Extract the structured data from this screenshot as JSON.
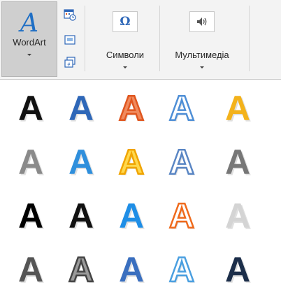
{
  "ribbon": {
    "wordart": {
      "label": "WordArt",
      "glyph": "A",
      "icon": "wordart-icon"
    },
    "small_buttons": [
      {
        "name": "date-time-icon"
      },
      {
        "name": "object-icon"
      },
      {
        "name": "slide-number-icon"
      }
    ],
    "symbols": {
      "label": "Символи",
      "glyph": "Ω",
      "icon": "omega-icon"
    },
    "multimedia": {
      "label": "Мультимедіа",
      "icon": "speaker-icon"
    }
  },
  "gallery": {
    "glyph": "A",
    "styles": [
      {
        "name": "wordart-fill-black-shadow",
        "fill": "#111111"
      },
      {
        "name": "wordart-fill-blue-accent1-shadow",
        "fill": "#2e67b8"
      },
      {
        "name": "wordart-fill-white-outline-orange",
        "fill": "#f08a5d",
        "stroke": "#e0561f"
      },
      {
        "name": "wordart-fill-white-outline-blue",
        "fill": "#ffffff",
        "stroke": "#4f8fd6"
      },
      {
        "name": "wordart-fill-gold-accent4",
        "fill": "#f3b21b"
      },
      {
        "name": "wordart-gradient-gray",
        "fill": "#8a8a8a"
      },
      {
        "name": "wordart-gradient-blue-reflection",
        "fill": "#2f8fdc"
      },
      {
        "name": "wordart-gradient-gold-outline",
        "fill": "#ffd84d",
        "stroke": "#f0a400"
      },
      {
        "name": "wordart-white-outline-blue-shadow",
        "fill": "#ffffff",
        "stroke": "#5a86c4"
      },
      {
        "name": "wordart-gradient-dark-gray",
        "fill": "#777777"
      },
      {
        "name": "wordart-fill-black-glow",
        "fill": "#000000"
      },
      {
        "name": "wordart-fill-black-blue-shadow",
        "fill": "#111111"
      },
      {
        "name": "wordart-fill-blue-bevel",
        "fill": "#1f8ee6"
      },
      {
        "name": "wordart-white-outline-orange-shadow",
        "fill": "#ffffff",
        "stroke": "#ef6a1c"
      },
      {
        "name": "wordart-light-gray-bevel",
        "fill": "#d4d4d4"
      },
      {
        "name": "wordart-pattern-dark-gray",
        "fill": "#555555"
      },
      {
        "name": "wordart-outline-gray-pattern",
        "fill": "#9a9a9a",
        "stroke": "#444444"
      },
      {
        "name": "wordart-blue-3d",
        "fill": "#3a6fbf"
      },
      {
        "name": "wordart-white-outline-light-blue",
        "fill": "#ffffff",
        "stroke": "#4a9fe0"
      },
      {
        "name": "wordart-pattern-navy",
        "fill": "#1c2e4a"
      }
    ]
  }
}
